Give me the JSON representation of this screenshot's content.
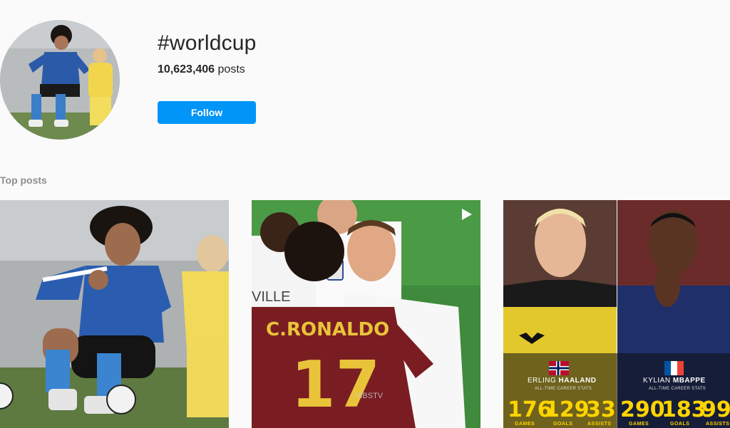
{
  "header": {
    "hashtag": "#worldcup",
    "post_count": "10,623,406",
    "post_suffix": "posts",
    "follow_label": "Follow"
  },
  "section": {
    "title": "Top posts"
  },
  "posts": [
    {
      "type": "photo"
    },
    {
      "type": "video",
      "icon": "play-icon",
      "jersey_name": "C.RONALDO",
      "jersey_number": "17",
      "watermark": "VIBSTV",
      "shirt_text": "VILLE"
    },
    {
      "type": "photo",
      "left": {
        "first_name": "ERLING",
        "last_name": "HAALAND",
        "subtitle": "ALL-TIME CAREER STATS",
        "flag": "norway",
        "stats": [
          {
            "value": "176",
            "label": "GAMES"
          },
          {
            "value": "129",
            "label": "GOALS"
          },
          {
            "value": "33",
            "label": "ASSISTS"
          }
        ]
      },
      "right": {
        "first_name": "KYLIAN",
        "last_name": "MBAPPE",
        "subtitle": "ALL-TIME CAREER STATS",
        "flag": "france",
        "stats": [
          {
            "value": "290",
            "label": "GAMES"
          },
          {
            "value": "183",
            "label": "GOALS"
          },
          {
            "value": "99",
            "label": "ASSISTS"
          }
        ]
      }
    }
  ],
  "colors": {
    "follow_button": "#0095f6",
    "stats_yellow": "#ffd400",
    "text_muted": "#8e8e8e"
  }
}
